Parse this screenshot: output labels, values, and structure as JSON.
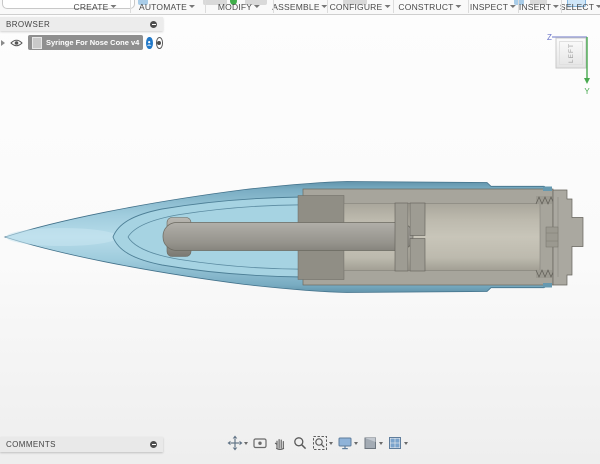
{
  "menubar": {
    "items": [
      {
        "label": "CREATE"
      },
      {
        "label": "AUTOMATE"
      },
      {
        "label": "MODIFY"
      },
      {
        "label": "ASSEMBLE"
      },
      {
        "label": "CONFIGURE"
      },
      {
        "label": "CONSTRUCT"
      },
      {
        "label": "INSPECT"
      },
      {
        "label": "INSERT"
      },
      {
        "label": "SELECT"
      }
    ]
  },
  "browser": {
    "title": "BROWSER",
    "component": {
      "name": "Syringe For Nose Cone v4"
    },
    "icons": [
      "expand-chevron",
      "visibility-eye",
      "component-document",
      "collaborator-avatar",
      "activate-component-radio",
      "panel-options-dot"
    ]
  },
  "comments": {
    "title": "COMMENTS",
    "icons": [
      "panel-options-dot"
    ]
  },
  "viewcube": {
    "face": "LEFT",
    "axes": {
      "z": "Z",
      "y": "Y"
    },
    "colors": {
      "z_axis": "#6a74c9",
      "y_axis": "#48a94f",
      "face_text": "#9a9a9a"
    }
  },
  "navbar": {
    "tools": [
      "orbit",
      "look-at",
      "pan",
      "zoom",
      "zoom-window",
      "display-settings",
      "grid-settings",
      "viewports"
    ]
  },
  "model": {
    "description": "Section view of a syringe assembly inside a rocket nose cone",
    "colors": {
      "shell_blue": "#9fccdd",
      "shell_blue_dark": "#5d8fa6",
      "cavity_blue": "#a6d3e2",
      "outline_blue": "#42718a",
      "syringe_gray": "#a7a59c",
      "bore_gray": "#c8c5b9",
      "plunger_gray": "#9e9c93",
      "flange_gray": "#908e85"
    }
  }
}
